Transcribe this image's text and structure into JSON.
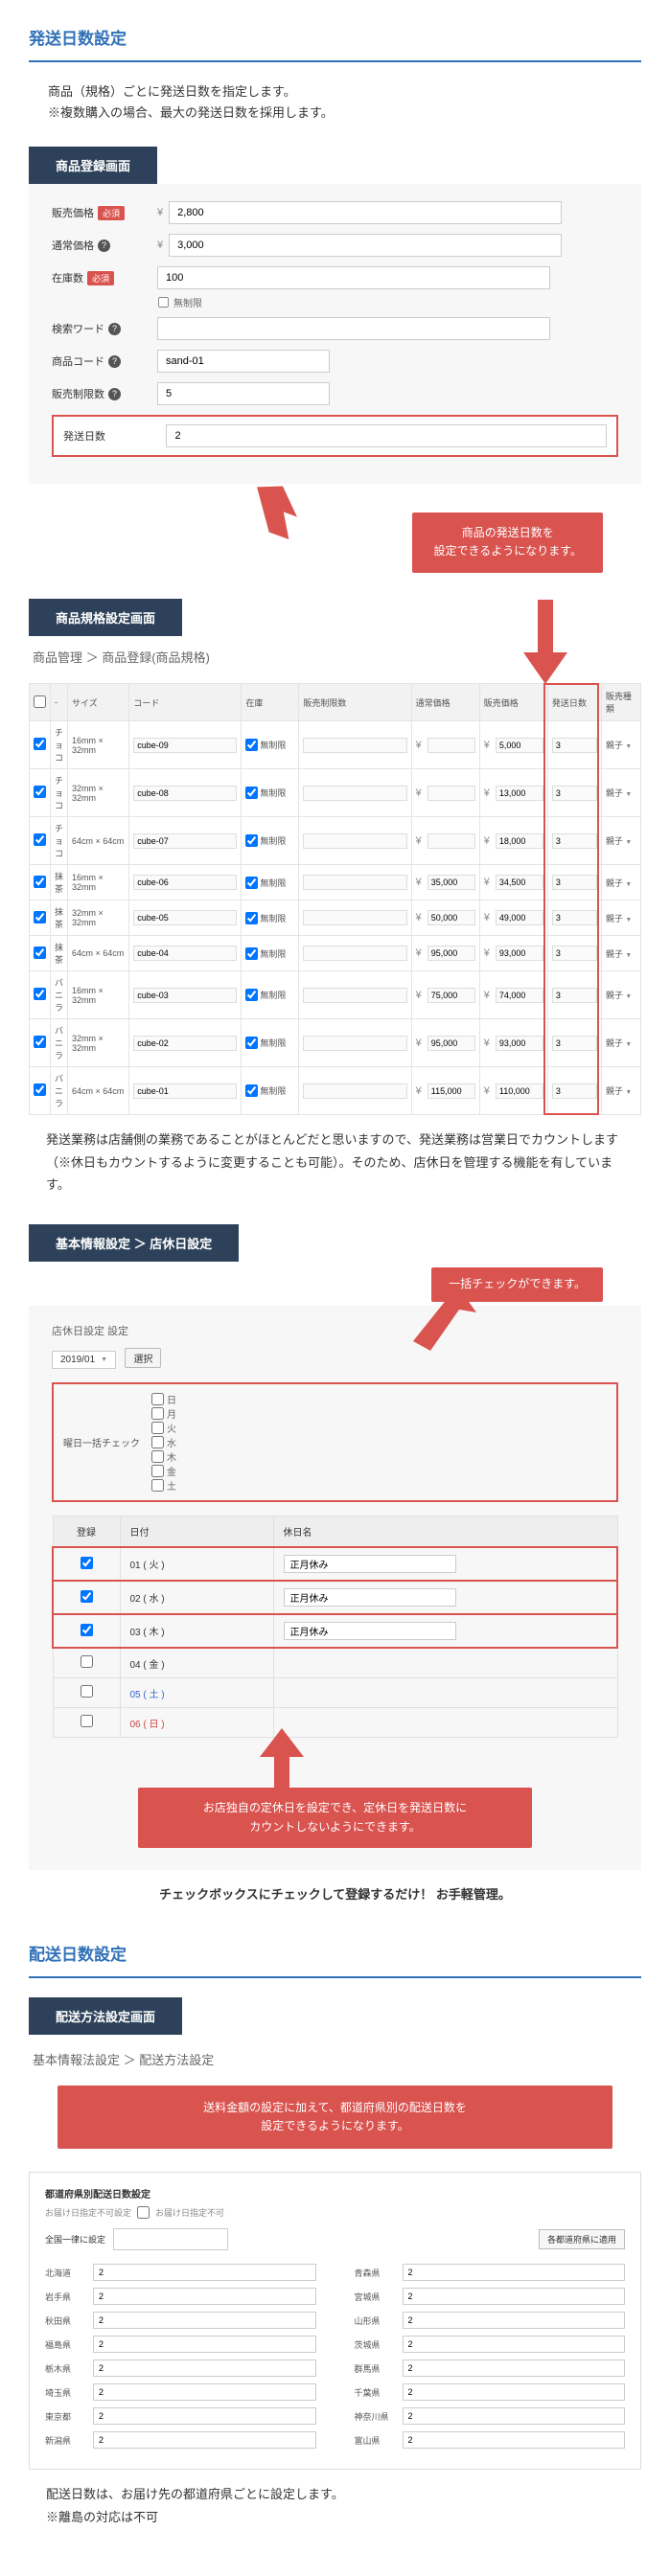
{
  "section1": {
    "title": "発送日数設定",
    "intro1": "商品（規格）ごとに発送日数を指定します。",
    "intro2": "※複数購入の場合、最大の発送日数を採用します。"
  },
  "panel1": {
    "title": "商品登録画面",
    "labels": {
      "sell": "販売価格",
      "normal": "通常価格",
      "stock": "在庫数",
      "search": "検索ワード",
      "code": "商品コード",
      "limit": "販売制限数",
      "ship": "発送日数",
      "req": "必須",
      "unlimited": "無制限"
    },
    "values": {
      "sell": "2,800",
      "normal": "3,000",
      "stock": "100",
      "search": "",
      "code": "sand-01",
      "limit": "5",
      "ship": "2"
    },
    "callout1": "商品の発送日数を",
    "callout2": "設定できるようになります。"
  },
  "panel2": {
    "title": "商品規格設定画面",
    "breadcrumb": "商品管理 ＞ 商品登録(商品規格)",
    "headers": {
      "size": "サイズ",
      "code": "コード",
      "stock": "在庫",
      "limit": "販売制限数",
      "normal": "通常価格",
      "sell": "販売価格",
      "ship": "発送日数",
      "type": "販売種類"
    },
    "muri": "無制限",
    "oya": "親子",
    "rows": [
      {
        "cat": "チョコ",
        "size": "16mm × 32mm",
        "code": "cube-09",
        "normal": "",
        "sell": "5,000",
        "ship": "3"
      },
      {
        "cat": "チョコ",
        "size": "32mm × 32mm",
        "code": "cube-08",
        "normal": "",
        "sell": "13,000",
        "ship": "3"
      },
      {
        "cat": "チョコ",
        "size": "64cm × 64cm",
        "code": "cube-07",
        "normal": "",
        "sell": "18,000",
        "ship": "3"
      },
      {
        "cat": "抹茶",
        "size": "16mm × 32mm",
        "code": "cube-06",
        "normal": "35,000",
        "sell": "34,500",
        "ship": "3"
      },
      {
        "cat": "抹茶",
        "size": "32mm × 32mm",
        "code": "cube-05",
        "normal": "50,000",
        "sell": "49,000",
        "ship": "3"
      },
      {
        "cat": "抹茶",
        "size": "64cm × 64cm",
        "code": "cube-04",
        "normal": "95,000",
        "sell": "93,000",
        "ship": "3"
      },
      {
        "cat": "バニラ",
        "size": "16mm × 32mm",
        "code": "cube-03",
        "normal": "75,000",
        "sell": "74,000",
        "ship": "3"
      },
      {
        "cat": "バニラ",
        "size": "32mm × 32mm",
        "code": "cube-02",
        "normal": "95,000",
        "sell": "93,000",
        "ship": "3"
      },
      {
        "cat": "バニラ",
        "size": "64cm × 64cm",
        "code": "cube-01",
        "normal": "115,000",
        "sell": "110,000",
        "ship": "3"
      }
    ],
    "desc": "発送業務は店舗側の業務であることがほとんどだと思いますので、発送業務は営業日でカウントします（※休日もカウントするように変更することも可能）。そのため、店休日を管理する機能を有しています。"
  },
  "panel3": {
    "title": "基本情報設定 ＞ 店休日設定",
    "callout_top": "一括チェックができます。",
    "subhead": "店休日設定 設定",
    "month": "2019/01",
    "month_btn": "選択",
    "dow_label": "曜日一括チェック",
    "dows": [
      "日",
      "月",
      "火",
      "水",
      "木",
      "金",
      "土"
    ],
    "th": {
      "reg": "登録",
      "date": "日付",
      "name": "休日名"
    },
    "rows": [
      {
        "d": "01 ( 火 )",
        "n": "正月休み",
        "sel": true
      },
      {
        "d": "02 ( 水 )",
        "n": "正月休み",
        "sel": true
      },
      {
        "d": "03 ( 木 )",
        "n": "正月休み",
        "sel": true
      },
      {
        "d": "04 ( 金 )",
        "n": "",
        "sel": false
      },
      {
        "d": "05 ( 土 )",
        "n": "",
        "sel": false,
        "cls": "sat"
      },
      {
        "d": "06 ( 日 )",
        "n": "",
        "sel": false,
        "cls": "sun"
      }
    ],
    "callout_mid1": "お店独自の定休日を設定でき、定休日を発送日数に",
    "callout_mid2": "カウントしないようにできます。",
    "footer": "チェックボックスにチェックして登録するだけ！ お手軽管理。"
  },
  "section2": {
    "title": "配送日数設定"
  },
  "panel4": {
    "title": "配送方法設定画面",
    "breadcrumb": "基本情報法設定 ＞ 配送方法設定",
    "callout1": "送料金額の設定に加えて、都道府県別の配送日数を",
    "callout2": "設定できるようになります。",
    "pref_title": "都道府県別配送日数設定",
    "sub_label": "お届け日指定不可設定",
    "sub_chk": "お届け日指定不可",
    "all_label": "全国一律に設定",
    "all_btn": "各都道府県に適用",
    "left": [
      {
        "p": "北海道",
        "v": "2"
      },
      {
        "p": "岩手県",
        "v": "2"
      },
      {
        "p": "秋田県",
        "v": "2"
      },
      {
        "p": "福島県",
        "v": "2"
      },
      {
        "p": "栃木県",
        "v": "2"
      },
      {
        "p": "埼玉県",
        "v": "2"
      },
      {
        "p": "東京都",
        "v": "2"
      },
      {
        "p": "新潟県",
        "v": "2"
      }
    ],
    "right": [
      {
        "p": "青森県",
        "v": "2"
      },
      {
        "p": "宮城県",
        "v": "2"
      },
      {
        "p": "山形県",
        "v": "2"
      },
      {
        "p": "茨城県",
        "v": "2"
      },
      {
        "p": "群馬県",
        "v": "2"
      },
      {
        "p": "千葉県",
        "v": "2"
      },
      {
        "p": "神奈川県",
        "v": "2"
      },
      {
        "p": "富山県",
        "v": "2"
      }
    ],
    "footer1": "配送日数は、お届け先の都道府県ごとに設定します。",
    "footer2": "※離島の対応は不可"
  }
}
